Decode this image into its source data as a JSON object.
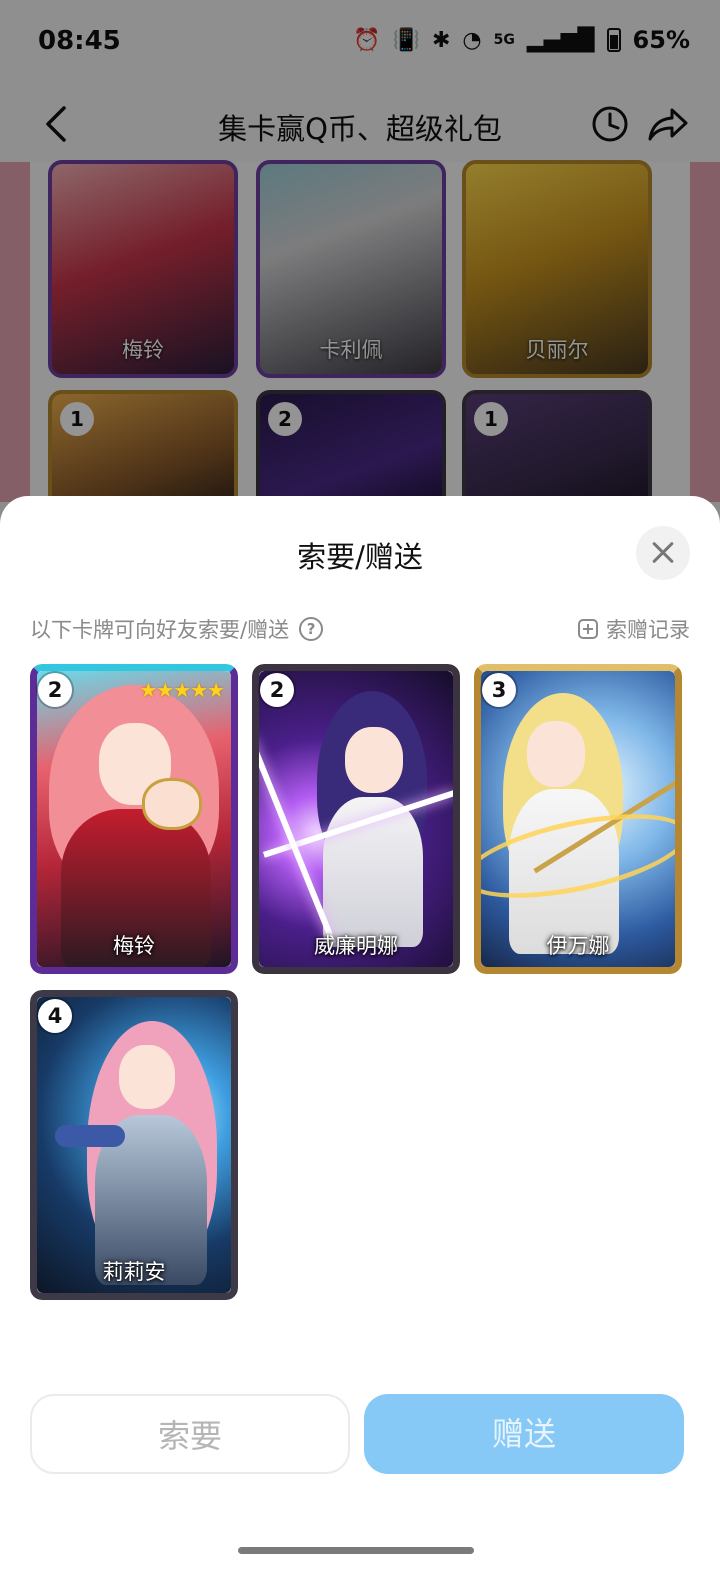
{
  "status_bar": {
    "time": "08:45",
    "network": "5G",
    "battery": "65%"
  },
  "nav": {
    "title": "集卡赢Q币、超级礼包"
  },
  "background_cards": [
    {
      "name": "梅铃"
    },
    {
      "name": "卡利佩"
    },
    {
      "name": "贝丽尔"
    },
    {
      "count": "1"
    },
    {
      "count": "2"
    },
    {
      "count": "1"
    }
  ],
  "sheet": {
    "title": "索要/赠送",
    "hint": "以下卡牌可向好友索要/赠送",
    "record_label": "索赠记录",
    "cards": [
      {
        "name": "梅铃",
        "count": "2",
        "stars": "★★★★★",
        "frame": "#4e2a86",
        "top": "#2fc0d8"
      },
      {
        "name": "威廉明娜",
        "count": "2",
        "stars": "",
        "frame": "#3c3540",
        "top": "#3c3540"
      },
      {
        "name": "伊万娜",
        "count": "3",
        "stars": "",
        "frame": "#b5882d",
        "top": "#e2c06a"
      },
      {
        "name": "莉莉安",
        "count": "4",
        "stars": "",
        "frame": "#3e3a48",
        "top": "#3e3a48"
      }
    ],
    "request_button": "索要",
    "gift_button": "赠送"
  }
}
